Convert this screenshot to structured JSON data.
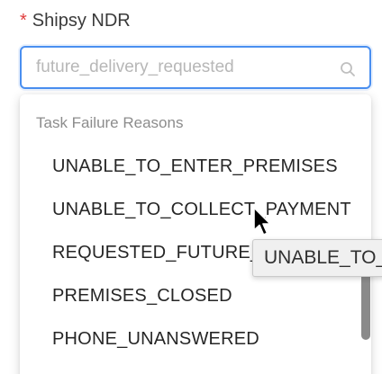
{
  "field": {
    "required_mark": "*",
    "label": "Shipsy NDR",
    "value": "future_delivery_requested",
    "search_icon": "search-icon"
  },
  "dropdown": {
    "group_title": "Task Failure Reasons",
    "options": [
      "UNABLE_TO_ENTER_PREMISES",
      "UNABLE_TO_COLLECT_PAYMENT",
      "REQUESTED_FUTURE_D",
      "PREMISES_CLOSED",
      "PHONE_UNANSWERED"
    ]
  },
  "tooltip": {
    "text": "UNABLE_TO_"
  },
  "colors": {
    "focus_border": "#4a8ff0",
    "required": "#e03c3c",
    "placeholder": "#b7b7b7"
  }
}
